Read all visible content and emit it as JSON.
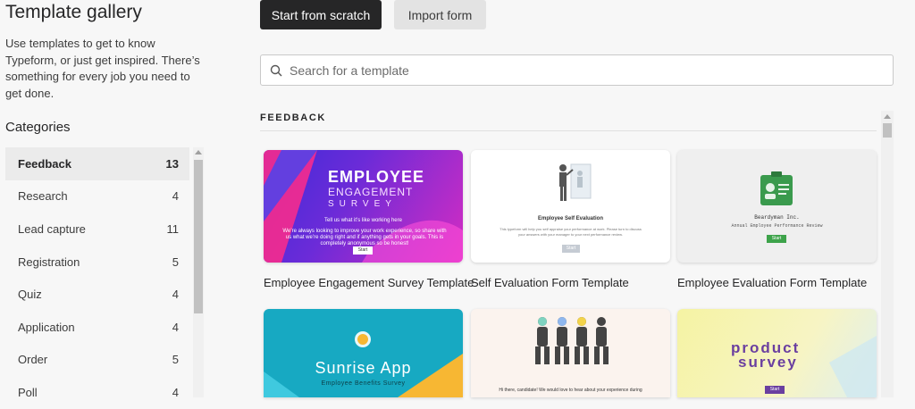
{
  "sidebar": {
    "title": "Template gallery",
    "description": "Use templates to get to know Typeform, or just get inspired. There’s something for every job you need to get done.",
    "categories_heading": "Categories",
    "categories": [
      {
        "label": "Feedback",
        "count": "13"
      },
      {
        "label": "Research",
        "count": "4"
      },
      {
        "label": "Lead capture",
        "count": "11"
      },
      {
        "label": "Registration",
        "count": "5"
      },
      {
        "label": "Quiz",
        "count": "4"
      },
      {
        "label": "Application",
        "count": "4"
      },
      {
        "label": "Order",
        "count": "5"
      },
      {
        "label": "Poll",
        "count": "4"
      }
    ]
  },
  "toolbar": {
    "start_label": "Start from scratch",
    "import_label": "Import form"
  },
  "search": {
    "placeholder": "Search for a template"
  },
  "section": {
    "label": "FEEDBACK"
  },
  "cards": [
    {
      "label": "Employee Engagement Survey Template",
      "thumb": {
        "title": "EMPLOYEE",
        "subtitle": "ENGAGEMENT",
        "word": "SURVEY",
        "tagline": "Tell us what it’s like working here",
        "body": "We’re always looking to improve your work experience, so share with us what we’re doing right and if anything gets in your goals. This is completely anonymous so be honest!",
        "button": "Start"
      }
    },
    {
      "label": "Self Evaluation Form Template",
      "thumb": {
        "title": "Employee Self Evaluation",
        "body": "This typeform will help you self appraise your performance at work. Please turn to discuss your answers with your manager to your next performance review.",
        "button": "Start"
      }
    },
    {
      "label": "Employee Evaluation Form Template",
      "thumb": {
        "company": "Beardyman Inc.",
        "subtitle": "Annual Employee Performance Review",
        "button": "Start"
      }
    },
    {
      "label": "",
      "thumb": {
        "title": "Sunrise App",
        "subtitle": "Employee Benefits Survey"
      }
    },
    {
      "label": "",
      "thumb": {
        "text": "Hi there, candidate! We would love to hear about your experience during"
      }
    },
    {
      "label": "",
      "thumb": {
        "title": "product",
        "word": "survey",
        "button": "Start"
      }
    }
  ],
  "colors": {
    "primary_button": "#262627",
    "secondary_button": "#e3e3e3",
    "active_category": "#ebebeb"
  }
}
